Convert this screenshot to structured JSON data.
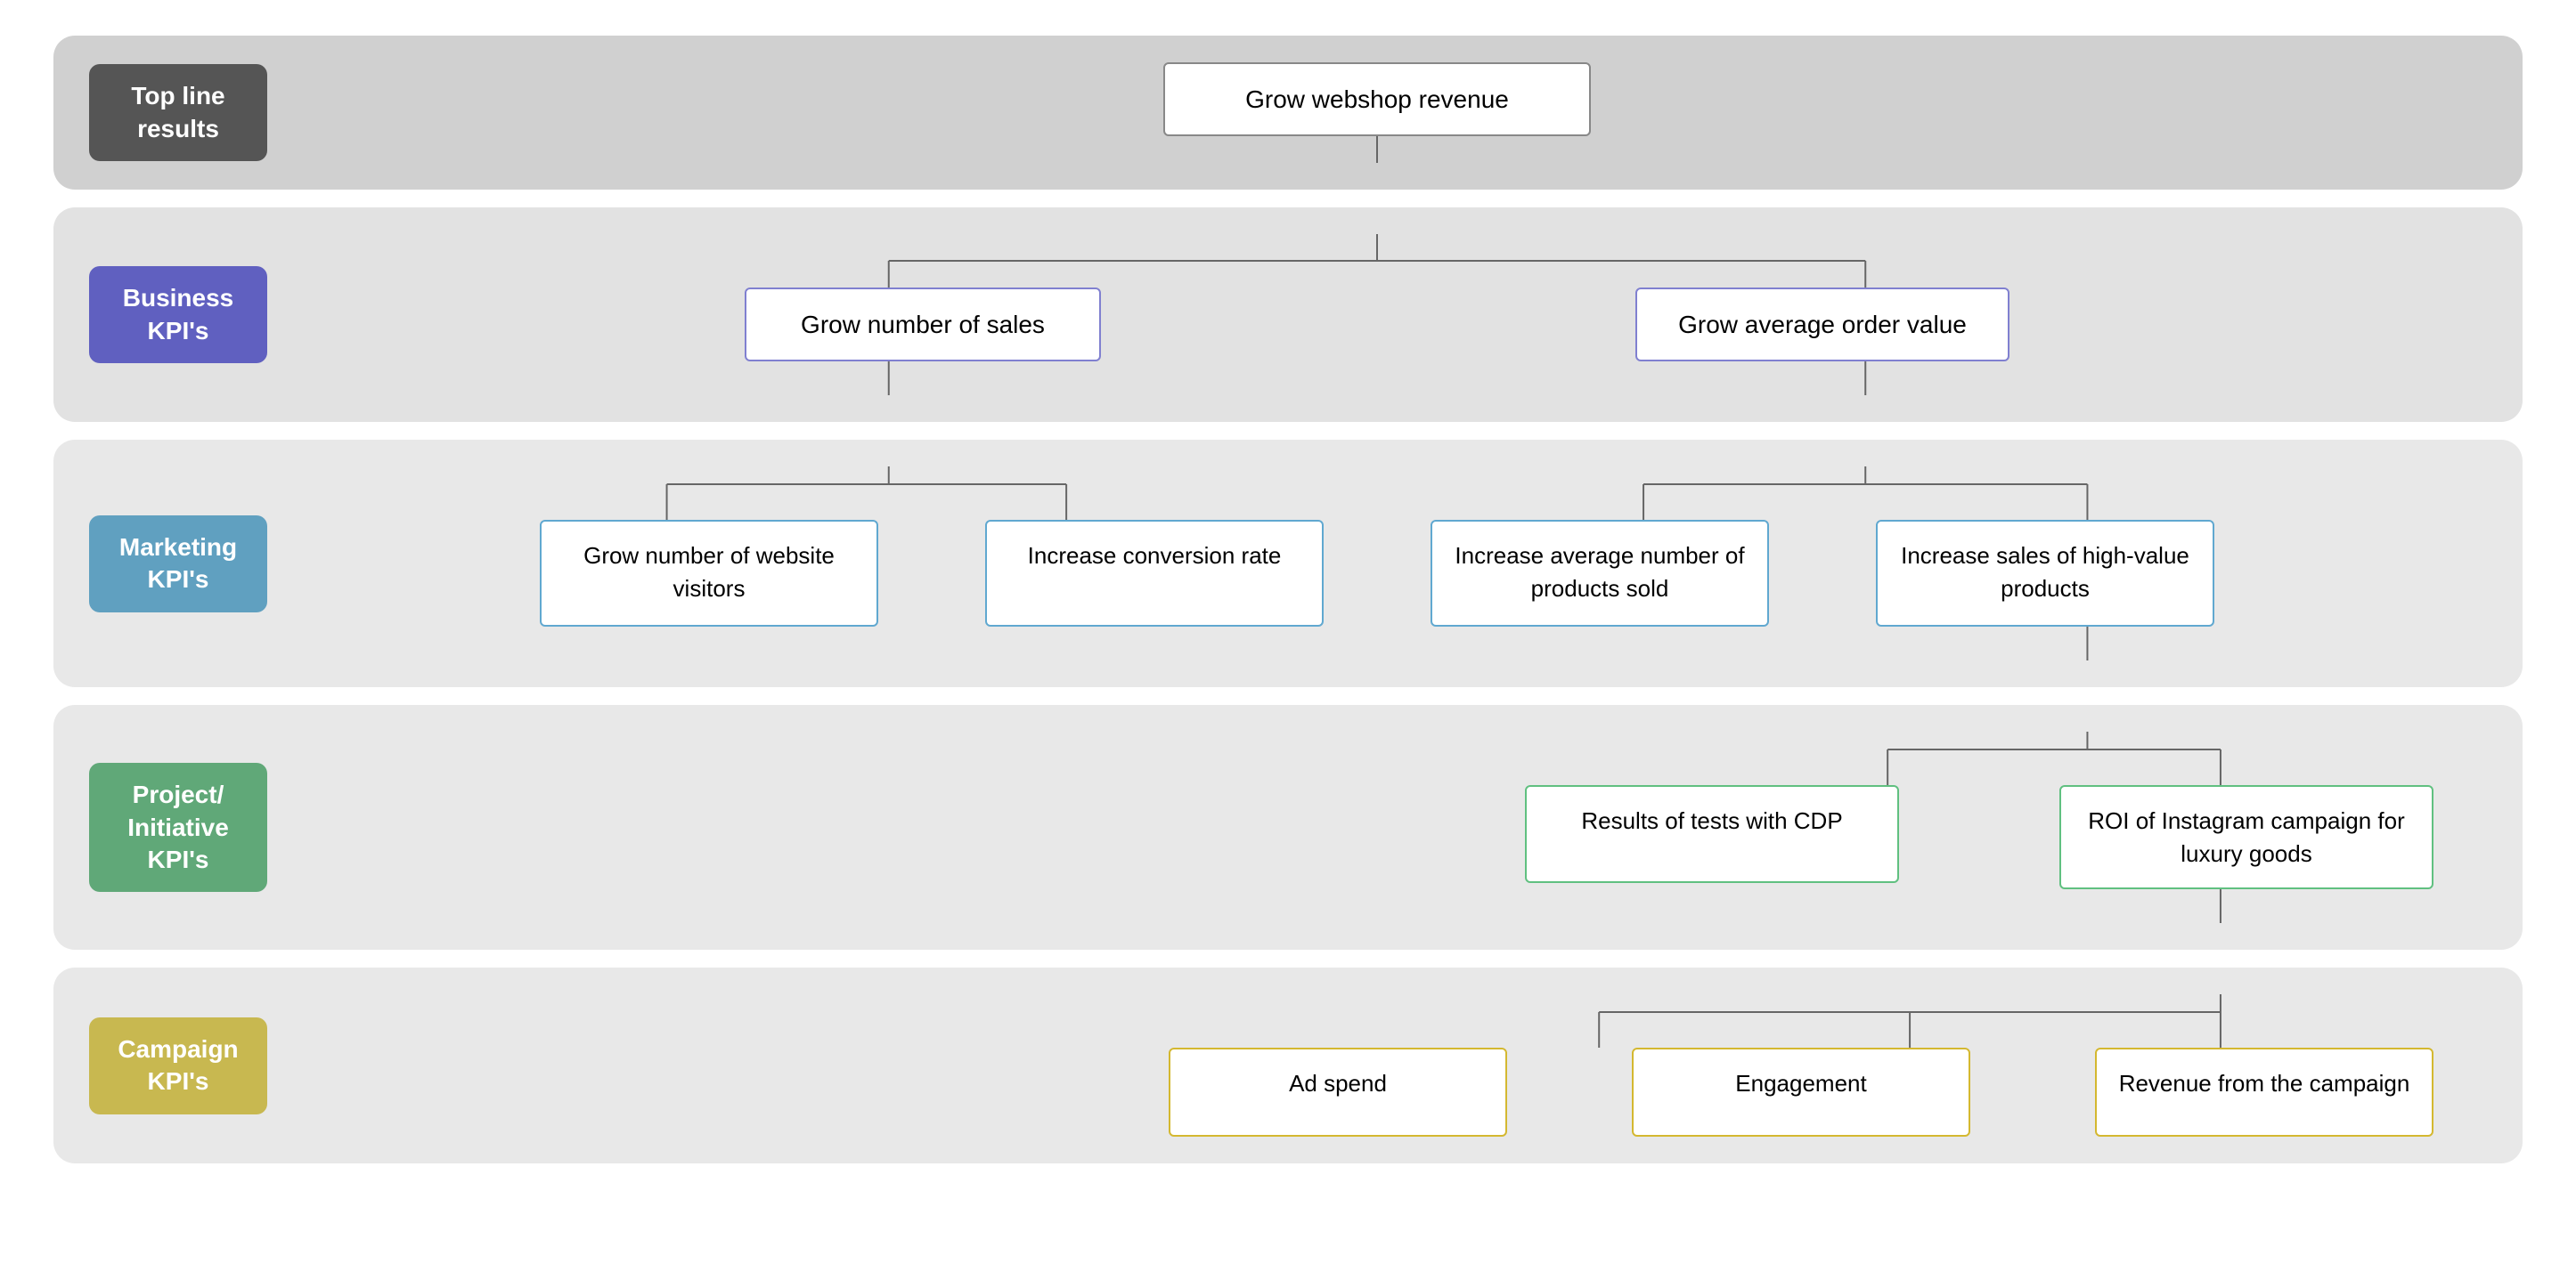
{
  "bands": {
    "top_line": {
      "label": "Top line results",
      "bg": "#d0d0d0",
      "label_bg": "#555555",
      "node": "Grow webshop revenue"
    },
    "business": {
      "label": "Business KPI's",
      "label_bg": "#6060c0",
      "nodes": [
        "Grow number of sales",
        "Grow average order value"
      ]
    },
    "marketing": {
      "label": "Marketing KPI's",
      "label_bg": "#60a0c0",
      "nodes": [
        "Grow number of website visitors",
        "Increase conversion rate",
        "Increase average number of products sold",
        "Increase sales of high-value products"
      ]
    },
    "project": {
      "label": "Project/ Initiative KPI's",
      "label_bg": "#60a878",
      "nodes": [
        "Results of tests with CDP",
        "ROI of Instagram campaign for luxury goods"
      ]
    },
    "campaign": {
      "label": "Campaign KPI's",
      "label_bg": "#c8b850",
      "nodes": [
        "Ad spend",
        "Engagement",
        "Revenue from the campaign"
      ]
    }
  }
}
